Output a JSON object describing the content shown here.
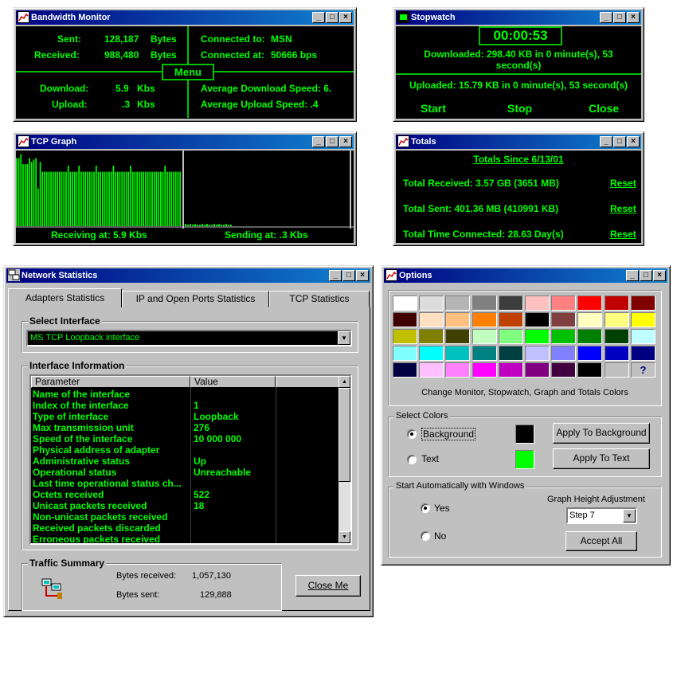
{
  "bandwidth": {
    "title": "Bandwidth Monitor",
    "sent_label": "Sent:",
    "sent_value": "128,187",
    "sent_unit": "Bytes",
    "received_label": "Received:",
    "received_value": "988,480",
    "received_unit": "Bytes",
    "connected_to_label": "Connected to:",
    "connected_to_value": "MSN",
    "connected_at_label": "Connected at:",
    "connected_at_value": "50666 bps",
    "menu_label": "Menu",
    "download_label": "Download:",
    "download_value": "5.9",
    "download_unit": "Kbs",
    "upload_label": "Upload:",
    "upload_value": ".3",
    "upload_unit": "Kbs",
    "avg_download": "Average Download Speed: 6.",
    "avg_upload": "Average Upload Speed: .4"
  },
  "stopwatch": {
    "title": "Stopwatch",
    "time": "00:00:53",
    "downloaded_line1": "Downloaded:  298.40 KB in 0 minute(s), 53",
    "downloaded_line2": "second(s)",
    "uploaded": "Uploaded:  15.79 KB in 0 minute(s), 53 second(s)",
    "start": "Start",
    "stop": "Stop",
    "close": "Close"
  },
  "tcp_graph": {
    "title": "TCP Graph",
    "receiving": "Receiving at: 5.9  Kbs",
    "sending": "Sending at: .3  Kbs",
    "receive_levels": [
      0.9,
      0.9,
      0.95,
      0.82,
      0.82,
      0.82,
      0.9,
      0.85,
      0.88,
      0.9,
      0.5,
      0.85,
      0.72,
      0.72,
      0.72,
      0.72,
      0.72,
      0.72,
      0.72,
      0.72,
      0.72,
      0.72,
      0.72,
      0.72,
      0.8,
      0.72,
      0.72,
      0.72,
      0.72,
      0.8,
      0.72,
      0.72,
      0.72,
      0.72,
      0.72,
      0.72,
      0.72,
      0.8,
      0.72,
      0.72,
      0.72,
      0.72,
      0.72,
      0.72,
      0.72,
      0.8,
      0.72,
      0.72,
      0.72,
      0.72,
      0.72,
      0.72,
      0.72,
      0.8,
      0.72,
      0.72,
      0.72,
      0.72,
      0.72,
      0.72,
      0.72,
      0.72,
      0.72,
      0.72,
      0.72,
      0.72,
      0.72,
      0.72,
      0.72,
      0.8,
      0.72,
      0.72,
      0.72,
      0.72,
      0.72,
      0.72,
      0.72
    ],
    "send_levels": [
      0.03,
      0.02,
      0.03,
      0.02,
      0.03,
      0.02,
      0.02,
      0.03,
      0.02,
      0.03,
      0.02,
      0.02,
      0.03,
      0.02,
      0.03,
      0.02,
      0.02,
      0.03,
      0.02,
      0.02
    ]
  },
  "totals": {
    "title": "Totals",
    "since": "Totals Since  6/13/01",
    "received": "Total Received:  3.57 GB   (3651 MB)",
    "sent": "Total Sent:  401.36 MB   (410991 KB)",
    "time": "Total Time Connected:  28.63 Day(s)",
    "reset": "Reset"
  },
  "netstats": {
    "title": "Network Statistics",
    "tabs": [
      "Adapters Statistics",
      "IP and Open Ports Statistics",
      "TCP Statistics"
    ],
    "select_interface_label": "Select Interface",
    "selected_interface": "MS TCP Loopback interface",
    "interface_info_label": "Interface Information",
    "col_parameter": "Parameter",
    "col_value": "Value",
    "rows": [
      {
        "p": "Name of the interface",
        "v": ""
      },
      {
        "p": "Index of the interface",
        "v": "1"
      },
      {
        "p": "Type of interface",
        "v": "Loopback"
      },
      {
        "p": "Max transmission unit",
        "v": "276"
      },
      {
        "p": "Speed of the interface",
        "v": "10 000 000"
      },
      {
        "p": "Physical address of adapter",
        "v": ""
      },
      {
        "p": "Administrative status",
        "v": "Up"
      },
      {
        "p": "Operational status",
        "v": "Unreachable"
      },
      {
        "p": "Last time operational status ch...",
        "v": ""
      },
      {
        "p": "Octets received",
        "v": "522"
      },
      {
        "p": "Unicast packets received",
        "v": "18"
      },
      {
        "p": "Non-unicast packets received",
        "v": ""
      },
      {
        "p": "Received packets discarded",
        "v": ""
      },
      {
        "p": "Erroneous packets received",
        "v": ""
      }
    ],
    "traffic_label": "Traffic Summary",
    "bytes_received_label": "Bytes received:",
    "bytes_received": "1,057,130",
    "bytes_sent_label": "Bytes sent:",
    "bytes_sent": "129,888",
    "close_me": "Close Me"
  },
  "options": {
    "title": "Options",
    "palette": [
      "#ffffff",
      "#dcdcdc",
      "#b4b4b4",
      "#808080",
      "#3c3c3c",
      "#ffc0c0",
      "#ff8080",
      "#ff0000",
      "#c00000",
      "#800000",
      "#400000",
      "#ffe0c0",
      "#ffc080",
      "#ff8000",
      "#c04000",
      "#000000",
      "#804040",
      "#ffffc0",
      "#ffff80",
      "#ffff00",
      "#c0c000",
      "#808000",
      "#404000",
      "#c0ffc0",
      "#80ff80",
      "#00ff00",
      "#00c000",
      "#008000",
      "#004000",
      "#c0ffff",
      "#80ffff",
      "#00ffff",
      "#00c0c0",
      "#008080",
      "#004040",
      "#c0c0ff",
      "#8080ff",
      "#0000ff",
      "#0000c0",
      "#000080",
      "#000040",
      "#ffc0ff",
      "#ff80ff",
      "#ff00ff",
      "#c000c0",
      "#800080",
      "#400040",
      "#000000",
      "#c0c0c0"
    ],
    "help_glyph": "?",
    "palette_caption": "Change Monitor, Stopwatch, Graph and Totals Colors",
    "select_colors_label": "Select Colors",
    "background_label": "Background",
    "text_label": "Text",
    "background_color": "#000000",
    "text_color": "#00ff00",
    "apply_bg": "Apply To Background",
    "apply_text": "Apply To Text",
    "autostart_label": "Start Automatically with Windows",
    "yes": "Yes",
    "no": "No",
    "graph_height_label": "Graph Height Adjustment",
    "graph_height_value": "Step 7",
    "accept_all": "Accept All"
  },
  "window_buttons": {
    "min": "_",
    "max": "□",
    "close": "×"
  },
  "colors": {
    "accent_green": "#00ff00",
    "display_bg": "#000000",
    "titlebar": "#000080"
  }
}
